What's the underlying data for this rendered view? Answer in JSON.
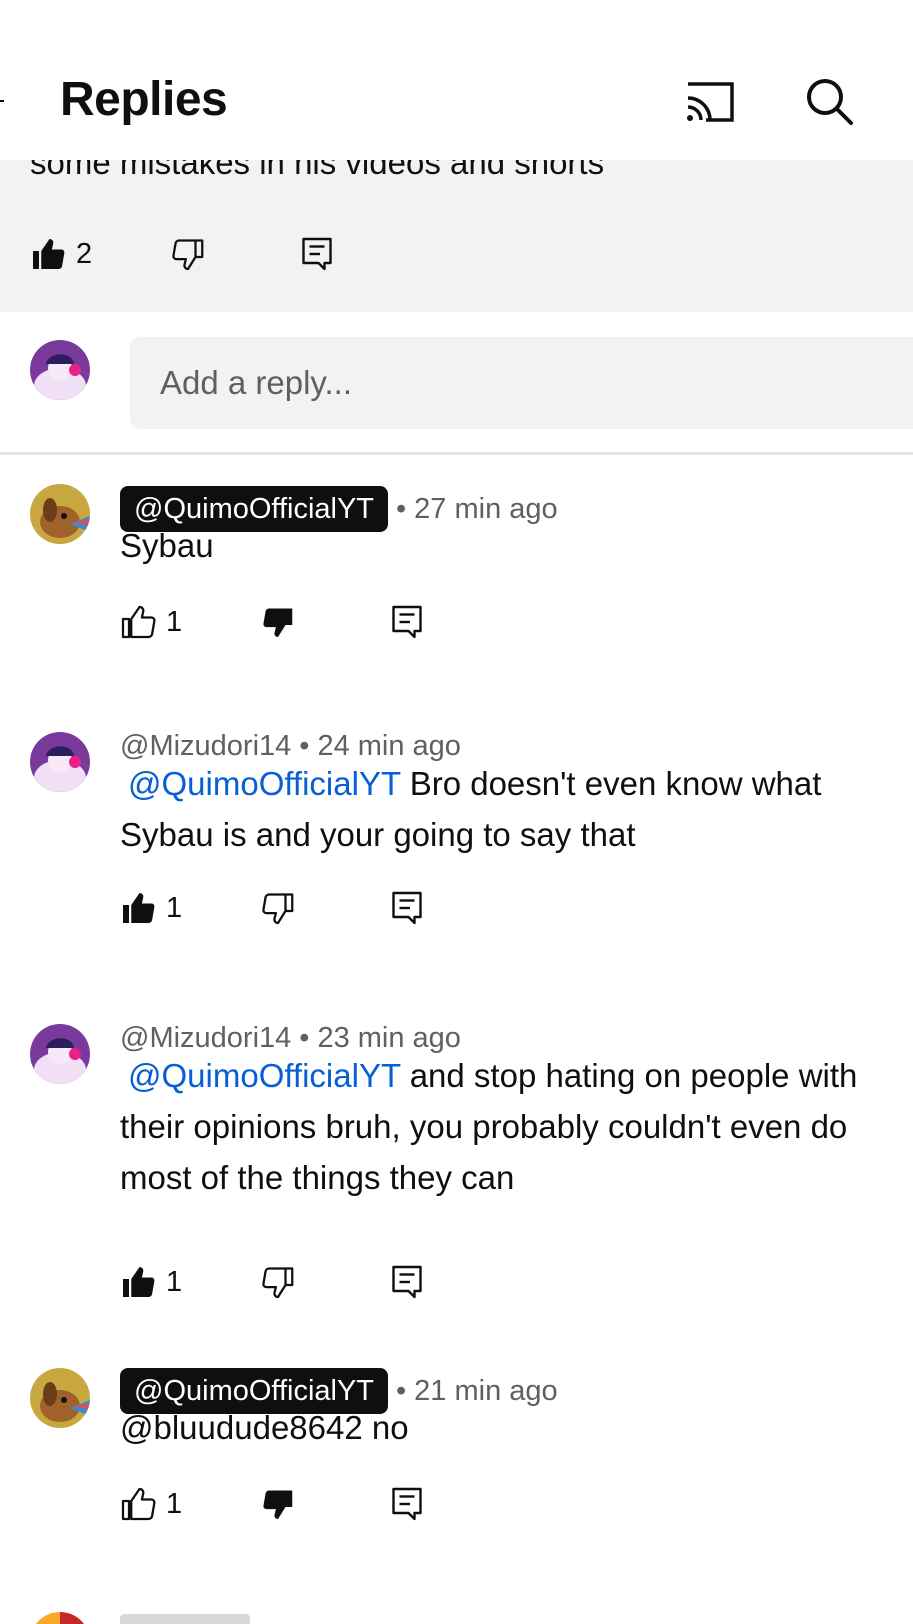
{
  "header": {
    "title": "Replies"
  },
  "parent_comment": {
    "text_fragment": "some mistakes in his videos and shorts",
    "like_count": "2"
  },
  "reply_box": {
    "placeholder": "Add a reply..."
  },
  "comments": [
    {
      "author": "@QuimoOfficialYT",
      "time": "27 min ago",
      "mention": "",
      "text": "Sybau",
      "likes": "1"
    },
    {
      "author": "@Mizudori14",
      "time": "24 min ago",
      "mention": "@QuimoOfficialYT",
      "text": "Bro doesn't even know what Sybau is and your going to say that",
      "likes": "1"
    },
    {
      "author": "@Mizudori14",
      "time": "23 min ago",
      "mention": "@QuimoOfficialYT",
      "text": "and stop hating on people with their opinions bruh, you probably couldn't even do most of the things they can",
      "likes": "1"
    },
    {
      "author": "@QuimoOfficialYT",
      "time": "21 min ago",
      "mention": "",
      "text": "@bluudude8642 no",
      "likes": "1"
    }
  ],
  "icons": {
    "header": [
      "cast-icon",
      "search-icon"
    ],
    "actions": [
      "thumbs-up-icon",
      "thumbs-down-icon",
      "reply-icon"
    ]
  },
  "colors": {
    "mention": "#065fd4",
    "secondary_text": "#606060",
    "panel": "#f2f2f2"
  }
}
